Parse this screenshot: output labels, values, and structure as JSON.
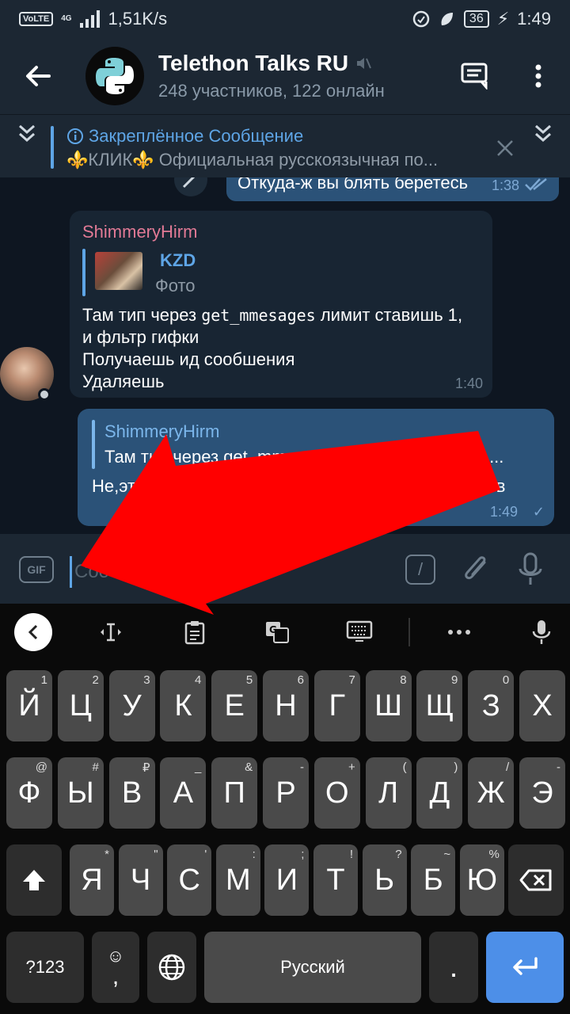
{
  "status_bar": {
    "volte": "VoLTE",
    "network": "4G",
    "speed": "1,51K/s",
    "battery": "36",
    "time": "1:49"
  },
  "header": {
    "title": "Telethon Talks RU",
    "subtitle": "248 участников, 122 онлайн"
  },
  "pinned": {
    "title": "Закреплённое Сообщение",
    "text": "⚜️КЛИК⚜️ Официальная русскоязычная по..."
  },
  "messages": {
    "out_top": {
      "text": "Откуда-ж вы блять беретесь",
      "time": "1:38"
    },
    "in_msg": {
      "author": "ShimmeryHirm",
      "reply_author": "KZD",
      "reply_text": "Фото",
      "line1_a": "Там тип через ",
      "line1_code": "get_mmesages",
      "line1_b": " лимит ставишь 1,",
      "line2": "и фльтр гифки",
      "line3": "Получаешь ид сообшения",
      "line4": "Удаляешь",
      "time": "1:40"
    },
    "out_msg": {
      "reply_author": "ShimmeryHirm",
      "reply_text": "Там тип через get_mmesages лимит ставишь 1,...",
      "body": "Не,это гифки не в чате, а от определенные юзеров",
      "time": "1:49",
      "tick": "✓"
    }
  },
  "input": {
    "gif_label": "GIF",
    "placeholder": "Сообщение",
    "slash": "/"
  },
  "keyboard": {
    "row1": [
      {
        "k": "Й",
        "h": "1"
      },
      {
        "k": "Ц",
        "h": "2"
      },
      {
        "k": "У",
        "h": "3"
      },
      {
        "k": "К",
        "h": "4"
      },
      {
        "k": "Е",
        "h": "5"
      },
      {
        "k": "Н",
        "h": "6"
      },
      {
        "k": "Г",
        "h": "7"
      },
      {
        "k": "Ш",
        "h": "8"
      },
      {
        "k": "Щ",
        "h": "9"
      },
      {
        "k": "З",
        "h": "0"
      },
      {
        "k": "Х",
        "h": ""
      }
    ],
    "row2": [
      {
        "k": "Ф",
        "h": "@"
      },
      {
        "k": "Ы",
        "h": "#"
      },
      {
        "k": "В",
        "h": "₽"
      },
      {
        "k": "А",
        "h": "_"
      },
      {
        "k": "П",
        "h": "&"
      },
      {
        "k": "Р",
        "h": "-"
      },
      {
        "k": "О",
        "h": "+"
      },
      {
        "k": "Л",
        "h": "("
      },
      {
        "k": "Д",
        "h": ")"
      },
      {
        "k": "Ж",
        "h": "/"
      },
      {
        "k": "Э",
        "h": "-"
      }
    ],
    "row3": [
      {
        "k": "Я",
        "h": "*"
      },
      {
        "k": "Ч",
        "h": "\""
      },
      {
        "k": "С",
        "h": "'"
      },
      {
        "k": "М",
        "h": ":"
      },
      {
        "k": "И",
        "h": ";"
      },
      {
        "k": "Т",
        "h": "!"
      },
      {
        "k": "Ь",
        "h": "?"
      },
      {
        "k": "Б",
        "h": "~"
      },
      {
        "k": "Ю",
        "h": "%"
      }
    ],
    "sym_label": "?123",
    "emoji_top": "☺",
    "comma": ",",
    "space_label": "Русский",
    "period": "."
  },
  "colors": {
    "accent": "#5ea5e6",
    "outgoing_bubble": "#2b5278",
    "incoming_bubble": "#182533",
    "author_pink": "#e27a96",
    "arrow_red": "#ff0000"
  }
}
